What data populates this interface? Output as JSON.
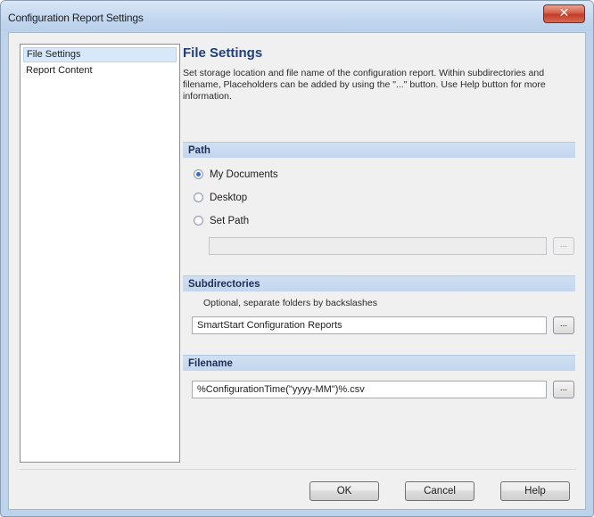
{
  "window": {
    "title": "Configuration Report Settings",
    "close_symbol": "✕"
  },
  "nav": {
    "items": [
      {
        "label": "File Settings"
      },
      {
        "label": "Report Content"
      }
    ]
  },
  "main": {
    "title": "File Settings",
    "description": "Set storage location and file name of the configuration report. Within subdirectories and filename, Placeholders can be added by using the \"...\" button. Use Help button for more information."
  },
  "path": {
    "header": "Path",
    "options": [
      {
        "label": "My Documents"
      },
      {
        "label": "Desktop"
      },
      {
        "label": "Set Path"
      }
    ],
    "selected_option": "My Documents",
    "custom_path_value": "",
    "browse_label": "..."
  },
  "subdirectories": {
    "header": "Subdirectories",
    "hint": "Optional, separate folders by backslashes",
    "value": "SmartStart Configuration Reports",
    "browse_label": "..."
  },
  "filename": {
    "header": "Filename",
    "value": "%ConfigurationTime(\"yyyy-MM\")%.csv",
    "browse_label": "..."
  },
  "buttons": {
    "ok": "OK",
    "cancel": "Cancel",
    "help": "Help"
  }
}
